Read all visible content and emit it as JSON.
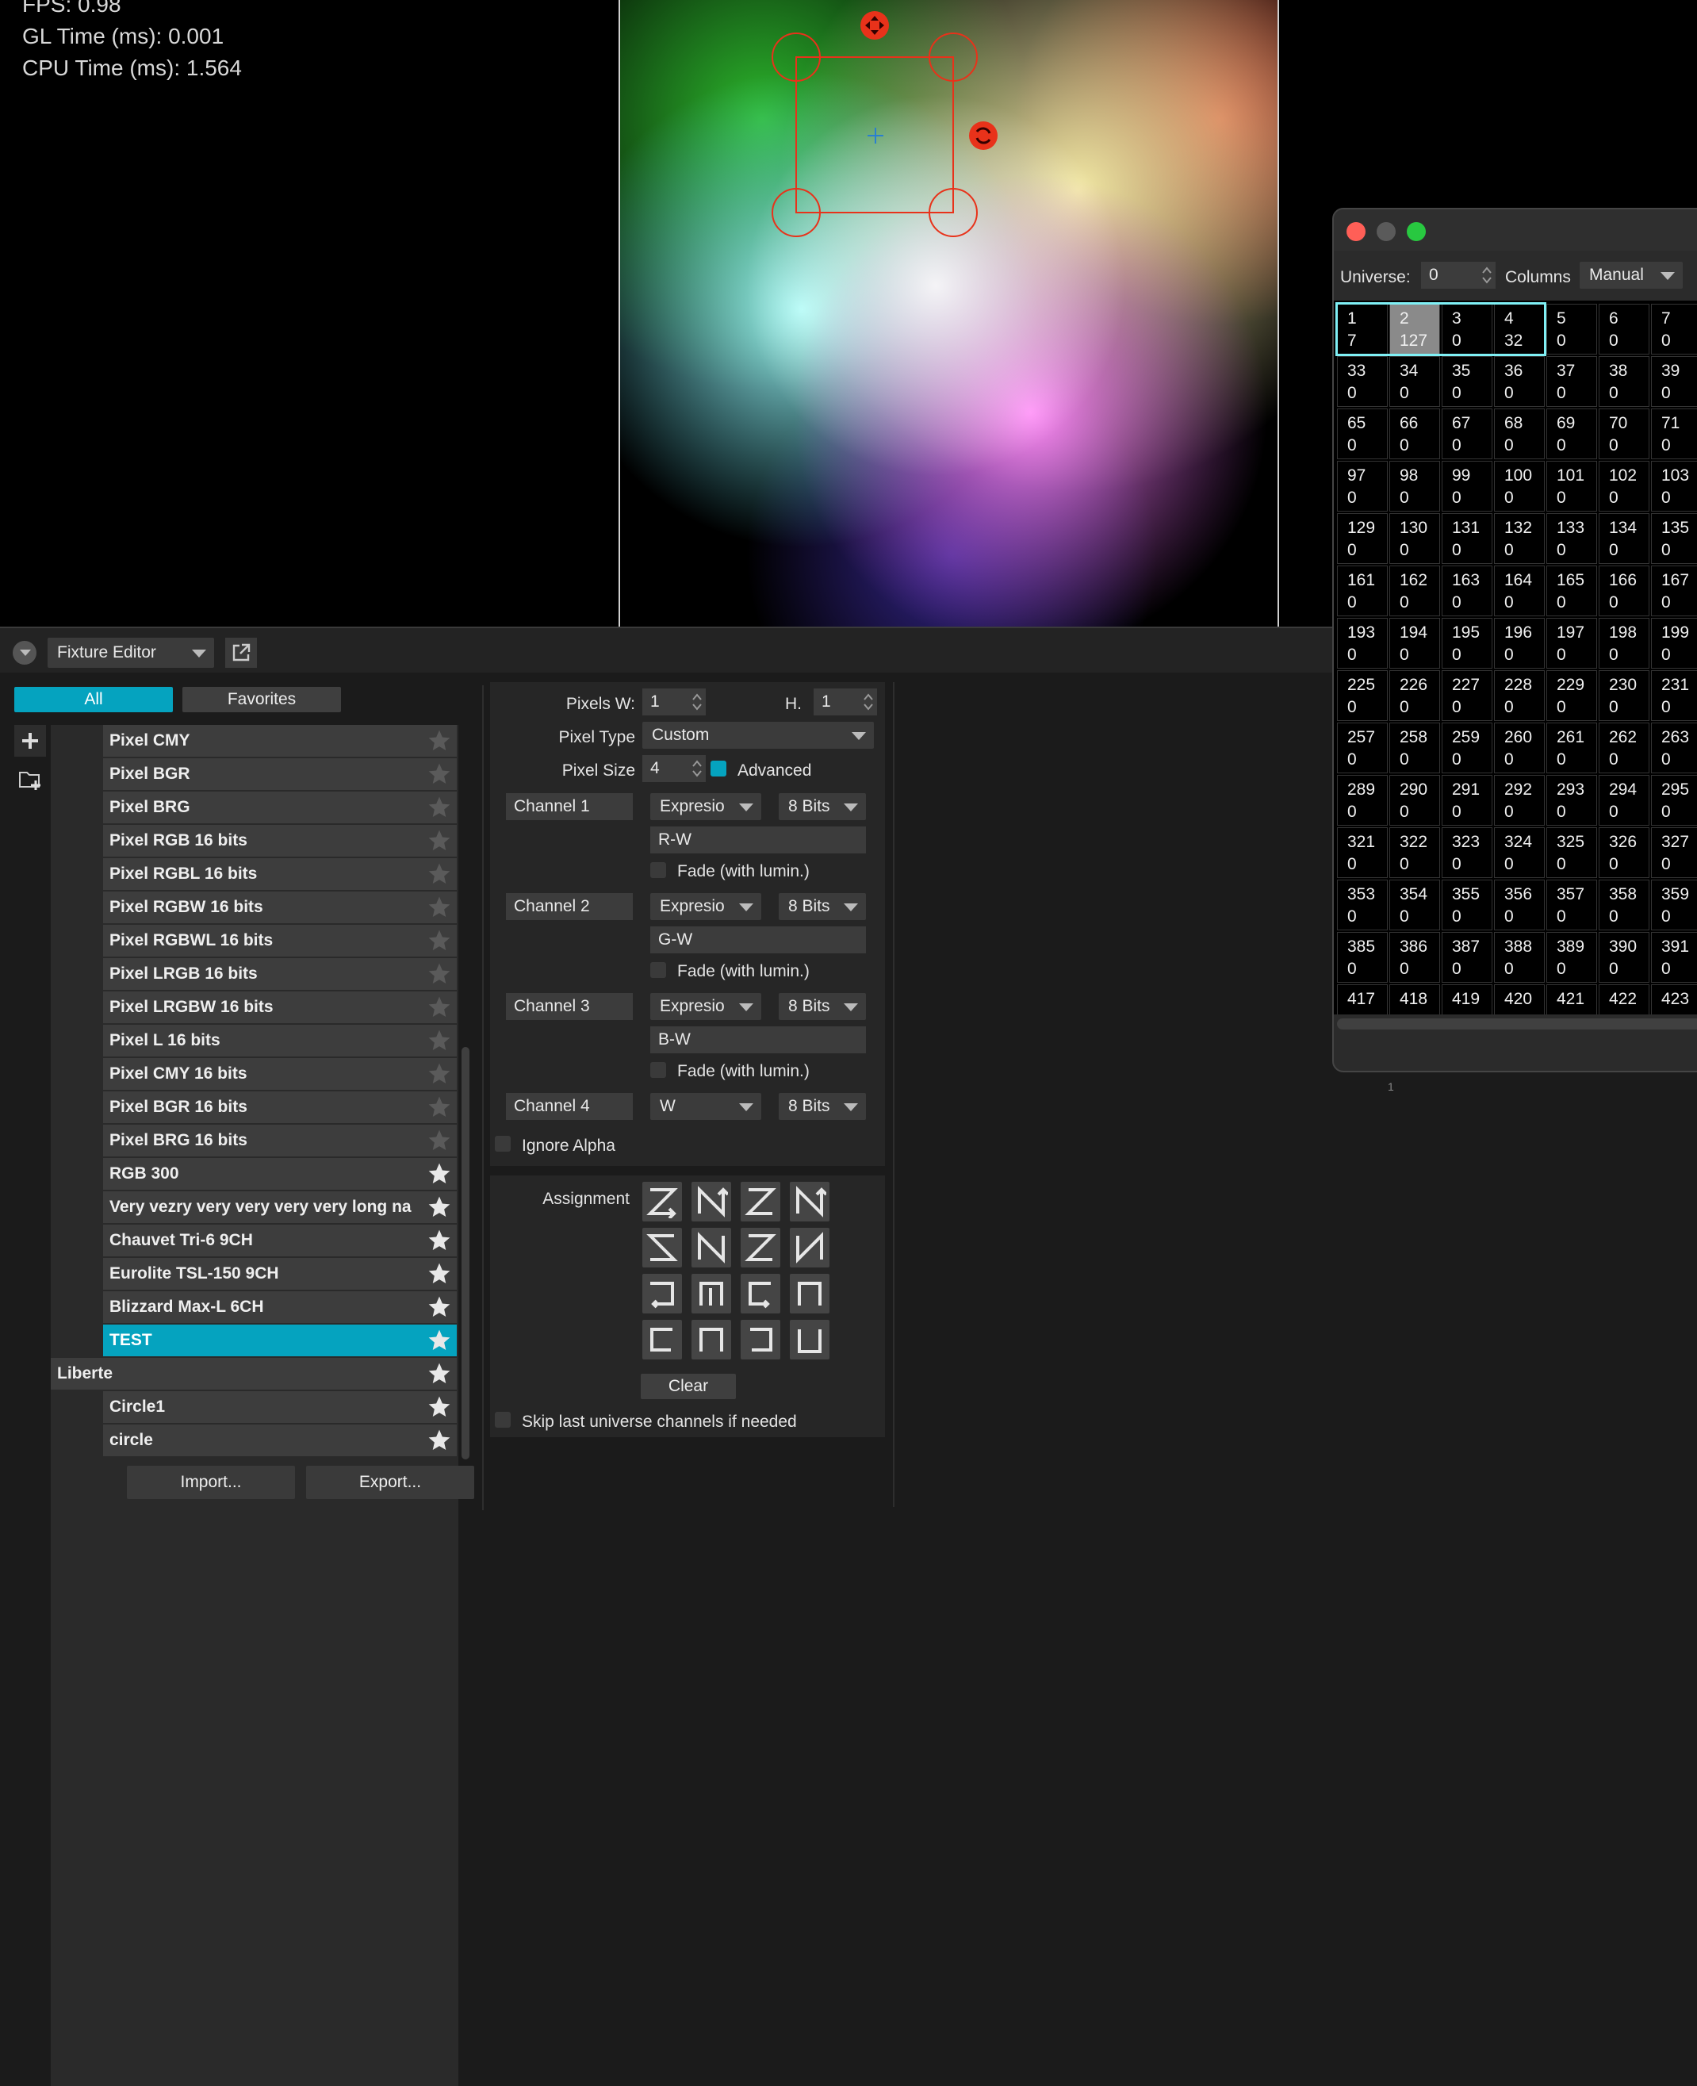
{
  "stats": {
    "fps": "FPS: 0.98",
    "gl_time": "GL Time (ms): 0.001",
    "cpu_time": "CPU Time (ms): 1.564"
  },
  "panel": {
    "editor_select": "Fixture Editor",
    "tabs": {
      "all": "All",
      "favorites": "Favorites"
    }
  },
  "fixture_list": {
    "items": [
      {
        "label": "Pixel CMY",
        "indent": "child",
        "favorite": false,
        "selected": false
      },
      {
        "label": "Pixel BGR",
        "indent": "child",
        "favorite": false,
        "selected": false
      },
      {
        "label": "Pixel BRG",
        "indent": "child",
        "favorite": false,
        "selected": false
      },
      {
        "label": "Pixel RGB 16 bits",
        "indent": "child",
        "favorite": false,
        "selected": false
      },
      {
        "label": "Pixel RGBL 16 bits",
        "indent": "child",
        "favorite": false,
        "selected": false
      },
      {
        "label": "Pixel RGBW 16 bits",
        "indent": "child",
        "favorite": false,
        "selected": false
      },
      {
        "label": "Pixel RGBWL 16 bits",
        "indent": "child",
        "favorite": false,
        "selected": false
      },
      {
        "label": "Pixel LRGB 16 bits",
        "indent": "child",
        "favorite": false,
        "selected": false
      },
      {
        "label": "Pixel LRGBW 16 bits",
        "indent": "child",
        "favorite": false,
        "selected": false
      },
      {
        "label": "Pixel L 16 bits",
        "indent": "child",
        "favorite": false,
        "selected": false
      },
      {
        "label": "Pixel CMY 16 bits",
        "indent": "child",
        "favorite": false,
        "selected": false
      },
      {
        "label": "Pixel BGR 16 bits",
        "indent": "child",
        "favorite": false,
        "selected": false
      },
      {
        "label": "Pixel BRG 16 bits",
        "indent": "child",
        "favorite": false,
        "selected": false
      },
      {
        "label": "RGB 300",
        "indent": "child",
        "favorite": true,
        "selected": false
      },
      {
        "label": "Very vezry very very very very long na",
        "indent": "child",
        "favorite": true,
        "selected": false
      },
      {
        "label": "Chauvet Tri-6 9CH",
        "indent": "child",
        "favorite": true,
        "selected": false
      },
      {
        "label": "Eurolite TSL-150 9CH",
        "indent": "child",
        "favorite": true,
        "selected": false
      },
      {
        "label": "Blizzard Max-L 6CH",
        "indent": "child",
        "favorite": true,
        "selected": false
      },
      {
        "label": "TEST",
        "indent": "child",
        "favorite": true,
        "selected": true
      },
      {
        "label": "Liberte",
        "indent": "group",
        "favorite": true,
        "selected": false
      },
      {
        "label": "Circle1",
        "indent": "child",
        "favorite": true,
        "selected": false
      },
      {
        "label": "circle",
        "indent": "child",
        "favorite": true,
        "selected": false
      }
    ],
    "import_label": "Import...",
    "export_label": "Export..."
  },
  "editor": {
    "pixels_w_label": "Pixels W:",
    "pixels_w": "1",
    "pixels_h_label": "H.",
    "pixels_h": "1",
    "pixel_type_label": "Pixel Type",
    "pixel_type": "Custom",
    "pixel_size_label": "Pixel Size",
    "pixel_size": "4",
    "advanced_label": "Advanced",
    "channels": [
      {
        "name": "Channel 1",
        "mode": "Expresio",
        "bits": "8 Bits",
        "expression": "R-W",
        "fade_label": "Fade (with lumin.)"
      },
      {
        "name": "Channel 2",
        "mode": "Expresio",
        "bits": "8 Bits",
        "expression": "G-W",
        "fade_label": "Fade (with lumin.)"
      },
      {
        "name": "Channel 3",
        "mode": "Expresio",
        "bits": "8 Bits",
        "expression": "B-W",
        "fade_label": "Fade (with lumin.)"
      },
      {
        "name": "Channel 4",
        "mode": "W",
        "bits": "8 Bits"
      }
    ],
    "ignore_alpha_label": "Ignore Alpha",
    "assignment_label": "Assignment",
    "clear_label": "Clear",
    "skip_label": "Skip last universe channels if needed"
  },
  "dmx_window": {
    "universe_label": "Universe:",
    "universe_value": "0",
    "columns_label": "Columns",
    "columns_mode": "Manual",
    "footer_number": "1",
    "cells": [
      [
        "1",
        "7"
      ],
      [
        "2",
        "127"
      ],
      [
        "3",
        "0"
      ],
      [
        "4",
        "32"
      ],
      [
        "5",
        "0"
      ],
      [
        "6",
        "0"
      ],
      [
        "7",
        "0"
      ],
      [
        "33",
        "0"
      ],
      [
        "34",
        "0"
      ],
      [
        "35",
        "0"
      ],
      [
        "36",
        "0"
      ],
      [
        "37",
        "0"
      ],
      [
        "38",
        "0"
      ],
      [
        "39",
        "0"
      ],
      [
        "65",
        "0"
      ],
      [
        "66",
        "0"
      ],
      [
        "67",
        "0"
      ],
      [
        "68",
        "0"
      ],
      [
        "69",
        "0"
      ],
      [
        "70",
        "0"
      ],
      [
        "71",
        "0"
      ],
      [
        "97",
        "0"
      ],
      [
        "98",
        "0"
      ],
      [
        "99",
        "0"
      ],
      [
        "100",
        "0"
      ],
      [
        "101",
        "0"
      ],
      [
        "102",
        "0"
      ],
      [
        "103",
        "0"
      ],
      [
        "129",
        "0"
      ],
      [
        "130",
        "0"
      ],
      [
        "131",
        "0"
      ],
      [
        "132",
        "0"
      ],
      [
        "133",
        "0"
      ],
      [
        "134",
        "0"
      ],
      [
        "135",
        "0"
      ],
      [
        "161",
        "0"
      ],
      [
        "162",
        "0"
      ],
      [
        "163",
        "0"
      ],
      [
        "164",
        "0"
      ],
      [
        "165",
        "0"
      ],
      [
        "166",
        "0"
      ],
      [
        "167",
        "0"
      ],
      [
        "193",
        "0"
      ],
      [
        "194",
        "0"
      ],
      [
        "195",
        "0"
      ],
      [
        "196",
        "0"
      ],
      [
        "197",
        "0"
      ],
      [
        "198",
        "0"
      ],
      [
        "199",
        "0"
      ],
      [
        "225",
        "0"
      ],
      [
        "226",
        "0"
      ],
      [
        "227",
        "0"
      ],
      [
        "228",
        "0"
      ],
      [
        "229",
        "0"
      ],
      [
        "230",
        "0"
      ],
      [
        "231",
        "0"
      ],
      [
        "257",
        "0"
      ],
      [
        "258",
        "0"
      ],
      [
        "259",
        "0"
      ],
      [
        "260",
        "0"
      ],
      [
        "261",
        "0"
      ],
      [
        "262",
        "0"
      ],
      [
        "263",
        "0"
      ],
      [
        "289",
        "0"
      ],
      [
        "290",
        "0"
      ],
      [
        "291",
        "0"
      ],
      [
        "292",
        "0"
      ],
      [
        "293",
        "0"
      ],
      [
        "294",
        "0"
      ],
      [
        "295",
        "0"
      ],
      [
        "321",
        "0"
      ],
      [
        "322",
        "0"
      ],
      [
        "323",
        "0"
      ],
      [
        "324",
        "0"
      ],
      [
        "325",
        "0"
      ],
      [
        "326",
        "0"
      ],
      [
        "327",
        "0"
      ],
      [
        "353",
        "0"
      ],
      [
        "354",
        "0"
      ],
      [
        "355",
        "0"
      ],
      [
        "356",
        "0"
      ],
      [
        "357",
        "0"
      ],
      [
        "358",
        "0"
      ],
      [
        "359",
        "0"
      ],
      [
        "385",
        "0"
      ],
      [
        "386",
        "0"
      ],
      [
        "387",
        "0"
      ],
      [
        "388",
        "0"
      ],
      [
        "389",
        "0"
      ],
      [
        "390",
        "0"
      ],
      [
        "391",
        "0"
      ],
      [
        "417",
        "0"
      ],
      [
        "418",
        "0"
      ],
      [
        "419",
        "0"
      ],
      [
        "420",
        "0"
      ],
      [
        "421",
        "0"
      ],
      [
        "422",
        "0"
      ],
      [
        "423",
        "0"
      ]
    ]
  },
  "colors": {
    "accent": "#05a3bf",
    "handle": "#e8321a",
    "close": "#ff5f57",
    "minimize": "#5a5a5a",
    "maximize": "#28c840"
  }
}
